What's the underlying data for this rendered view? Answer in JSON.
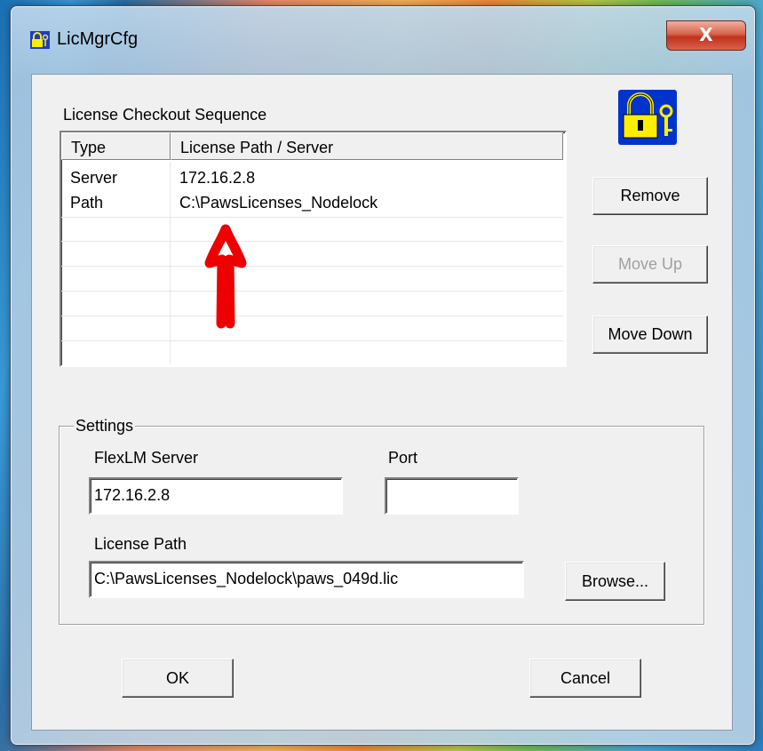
{
  "window": {
    "title": "LicMgrCfg",
    "close_glyph": "X"
  },
  "checkout": {
    "label": "License Checkout Sequence",
    "columns": [
      "Type",
      "License Path / Server"
    ],
    "rows": [
      {
        "type": "Server",
        "path": "172.16.2.8"
      },
      {
        "type": "Path",
        "path": "C:\\PawsLicenses_Nodelock"
      }
    ]
  },
  "buttons": {
    "remove": "Remove",
    "move_up": "Move Up",
    "move_down": "Move Down",
    "browse": "Browse...",
    "ok": "OK",
    "cancel": "Cancel"
  },
  "settings": {
    "group_label": "Settings",
    "flexlm_label": "FlexLM Server",
    "flexlm_value": "172.16.2.8",
    "port_label": "Port",
    "port_value": "",
    "license_path_label": "License Path",
    "license_path_value": "C:\\PawsLicenses_Nodelock\\paws_049d.lic"
  },
  "colors": {
    "annotation_arrow": "#ee0000",
    "lock_icon_bg": "#0033cc",
    "lock_icon_fg": "#ffee00"
  },
  "icons": {
    "title_icon": "lock-key-icon",
    "dialog_icon": "lock-key-icon",
    "annotation": "up-arrow-icon"
  }
}
